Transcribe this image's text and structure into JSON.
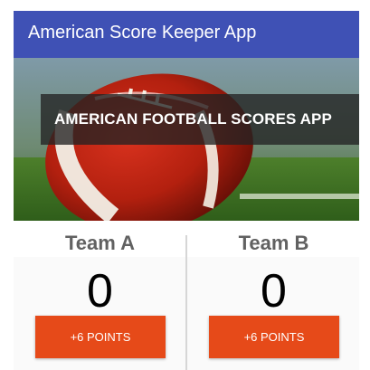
{
  "app_bar": {
    "title": "American Score Keeper App"
  },
  "hero": {
    "banner_text": "AMERICAN FOOTBALL SCORES APP"
  },
  "teams": [
    {
      "name": "Team A",
      "score": "0",
      "button_label": "+6 POINTS"
    },
    {
      "name": "Team B",
      "score": "0",
      "button_label": "+6 POINTS"
    }
  ],
  "colors": {
    "app_bar": "#3f51b5",
    "button": "#e64a19",
    "team_name": "#616161",
    "banner_overlay": "#232323"
  }
}
